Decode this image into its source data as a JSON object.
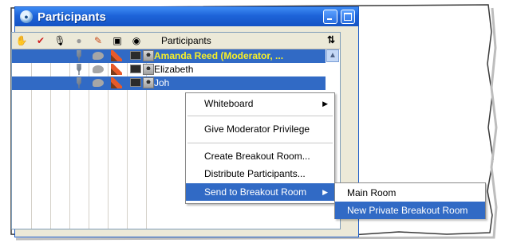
{
  "window": {
    "title": "Participants"
  },
  "header": {
    "icons": [
      "raise-hand-icon",
      "permission-icon",
      "microphone-icon",
      "chat-icon",
      "pencil-icon",
      "monitor-icon",
      "person-icon"
    ],
    "label": "Participants",
    "sort_icon": "⇅"
  },
  "participants": [
    {
      "name": "Amanda Reed (Moderator, ...",
      "selected": true,
      "moderator": true
    },
    {
      "name": "Elizabeth",
      "selected": false,
      "moderator": false
    },
    {
      "name": "Joh",
      "selected": true,
      "moderator": false
    }
  ],
  "context_menu": {
    "items": [
      {
        "label": "Whiteboard",
        "submenu": true
      },
      {
        "label": "Give Moderator Privilege"
      },
      {
        "label": "Create Breakout Room..."
      },
      {
        "label": "Distribute Participants..."
      },
      {
        "label": "Send to Breakout Room",
        "submenu": true,
        "highlighted": true
      }
    ]
  },
  "submenu": {
    "items": [
      {
        "label": "Main Room"
      },
      {
        "label": "New Private Breakout Room",
        "highlighted": true
      }
    ]
  },
  "colors": {
    "title_blue": "#1d63d8",
    "selection": "#316ac5",
    "moderator_text": "#f7ef28"
  }
}
